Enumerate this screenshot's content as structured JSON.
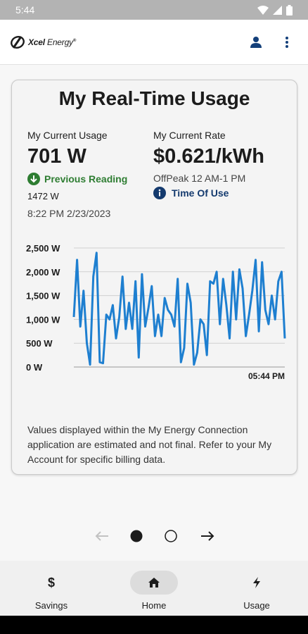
{
  "status_bar": {
    "time": "5:44"
  },
  "app_bar": {
    "logo_brand": "Xcel",
    "logo_word": "Energy",
    "logo_mark": "®",
    "account_icon": "person-icon",
    "menu_icon": "more-vert-icon"
  },
  "card": {
    "title": "My Real-Time Usage",
    "usage_label": "My Current Usage",
    "usage_value": "701 W",
    "previous_reading_label": "Previous Reading",
    "previous_reading_value": "1472 W",
    "reading_timestamp": "8:22 PM 2/23/2023",
    "rate_label": "My Current Rate",
    "rate_value": "$0.621/kWh",
    "rate_period": "OffPeak 12 AM-1 PM",
    "time_of_use_label": "Time Of Use",
    "disclaimer": "Values displayed within the My Energy Connection application are estimated and not final. Refer to your My Account for specific billing data."
  },
  "chart_data": {
    "type": "line",
    "ylim": [
      0,
      2500
    ],
    "y_ticks": [
      "2,500 W",
      "2,000 W",
      "1,500 W",
      "1,000 W",
      "500 W",
      "0 W"
    ],
    "x_end_label": "05:44 PM",
    "series": [
      {
        "color": "#1e7fd0",
        "values": [
          1050,
          2250,
          850,
          1600,
          500,
          50,
          1900,
          2400,
          100,
          80,
          1100,
          1000,
          1300,
          600,
          1050,
          1900,
          800,
          1350,
          800,
          1800,
          200,
          1950,
          850,
          1250,
          1700,
          650,
          1100,
          650,
          1450,
          1200,
          1100,
          850,
          1850,
          100,
          400,
          1750,
          1350,
          50,
          300,
          1000,
          900,
          250,
          1800,
          1750,
          2000,
          900,
          1850,
          1300,
          600,
          2000,
          1000,
          2050,
          1650,
          650,
          1100,
          1600,
          2250,
          750,
          2200,
          1200,
          900,
          1500,
          1000,
          1800,
          2000,
          600
        ]
      }
    ],
    "grid": true
  },
  "pager": {
    "prev_icon": "arrow-left-icon",
    "next_icon": "arrow-right-icon",
    "pages": 2,
    "current": 1
  },
  "bottom_nav": {
    "items": [
      {
        "label": "Savings",
        "icon": "dollar-icon"
      },
      {
        "label": "Home",
        "icon": "home-icon"
      },
      {
        "label": "Usage",
        "icon": "lightning-icon"
      }
    ]
  }
}
